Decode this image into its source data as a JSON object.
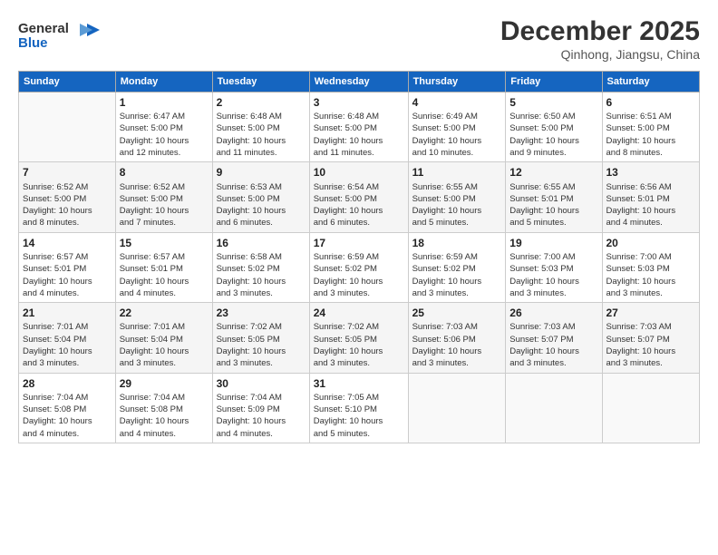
{
  "logo": {
    "line1": "General",
    "line2": "Blue"
  },
  "title": "December 2025",
  "subtitle": "Qinhong, Jiangsu, China",
  "headers": [
    "Sunday",
    "Monday",
    "Tuesday",
    "Wednesday",
    "Thursday",
    "Friday",
    "Saturday"
  ],
  "weeks": [
    [
      {
        "day": "",
        "info": ""
      },
      {
        "day": "1",
        "info": "Sunrise: 6:47 AM\nSunset: 5:00 PM\nDaylight: 10 hours\nand 12 minutes."
      },
      {
        "day": "2",
        "info": "Sunrise: 6:48 AM\nSunset: 5:00 PM\nDaylight: 10 hours\nand 11 minutes."
      },
      {
        "day": "3",
        "info": "Sunrise: 6:48 AM\nSunset: 5:00 PM\nDaylight: 10 hours\nand 11 minutes."
      },
      {
        "day": "4",
        "info": "Sunrise: 6:49 AM\nSunset: 5:00 PM\nDaylight: 10 hours\nand 10 minutes."
      },
      {
        "day": "5",
        "info": "Sunrise: 6:50 AM\nSunset: 5:00 PM\nDaylight: 10 hours\nand 9 minutes."
      },
      {
        "day": "6",
        "info": "Sunrise: 6:51 AM\nSunset: 5:00 PM\nDaylight: 10 hours\nand 8 minutes."
      }
    ],
    [
      {
        "day": "7",
        "info": "Sunrise: 6:52 AM\nSunset: 5:00 PM\nDaylight: 10 hours\nand 8 minutes."
      },
      {
        "day": "8",
        "info": "Sunrise: 6:52 AM\nSunset: 5:00 PM\nDaylight: 10 hours\nand 7 minutes."
      },
      {
        "day": "9",
        "info": "Sunrise: 6:53 AM\nSunset: 5:00 PM\nDaylight: 10 hours\nand 6 minutes."
      },
      {
        "day": "10",
        "info": "Sunrise: 6:54 AM\nSunset: 5:00 PM\nDaylight: 10 hours\nand 6 minutes."
      },
      {
        "day": "11",
        "info": "Sunrise: 6:55 AM\nSunset: 5:00 PM\nDaylight: 10 hours\nand 5 minutes."
      },
      {
        "day": "12",
        "info": "Sunrise: 6:55 AM\nSunset: 5:01 PM\nDaylight: 10 hours\nand 5 minutes."
      },
      {
        "day": "13",
        "info": "Sunrise: 6:56 AM\nSunset: 5:01 PM\nDaylight: 10 hours\nand 4 minutes."
      }
    ],
    [
      {
        "day": "14",
        "info": "Sunrise: 6:57 AM\nSunset: 5:01 PM\nDaylight: 10 hours\nand 4 minutes."
      },
      {
        "day": "15",
        "info": "Sunrise: 6:57 AM\nSunset: 5:01 PM\nDaylight: 10 hours\nand 4 minutes."
      },
      {
        "day": "16",
        "info": "Sunrise: 6:58 AM\nSunset: 5:02 PM\nDaylight: 10 hours\nand 3 minutes."
      },
      {
        "day": "17",
        "info": "Sunrise: 6:59 AM\nSunset: 5:02 PM\nDaylight: 10 hours\nand 3 minutes."
      },
      {
        "day": "18",
        "info": "Sunrise: 6:59 AM\nSunset: 5:02 PM\nDaylight: 10 hours\nand 3 minutes."
      },
      {
        "day": "19",
        "info": "Sunrise: 7:00 AM\nSunset: 5:03 PM\nDaylight: 10 hours\nand 3 minutes."
      },
      {
        "day": "20",
        "info": "Sunrise: 7:00 AM\nSunset: 5:03 PM\nDaylight: 10 hours\nand 3 minutes."
      }
    ],
    [
      {
        "day": "21",
        "info": "Sunrise: 7:01 AM\nSunset: 5:04 PM\nDaylight: 10 hours\nand 3 minutes."
      },
      {
        "day": "22",
        "info": "Sunrise: 7:01 AM\nSunset: 5:04 PM\nDaylight: 10 hours\nand 3 minutes."
      },
      {
        "day": "23",
        "info": "Sunrise: 7:02 AM\nSunset: 5:05 PM\nDaylight: 10 hours\nand 3 minutes."
      },
      {
        "day": "24",
        "info": "Sunrise: 7:02 AM\nSunset: 5:05 PM\nDaylight: 10 hours\nand 3 minutes."
      },
      {
        "day": "25",
        "info": "Sunrise: 7:03 AM\nSunset: 5:06 PM\nDaylight: 10 hours\nand 3 minutes."
      },
      {
        "day": "26",
        "info": "Sunrise: 7:03 AM\nSunset: 5:07 PM\nDaylight: 10 hours\nand 3 minutes."
      },
      {
        "day": "27",
        "info": "Sunrise: 7:03 AM\nSunset: 5:07 PM\nDaylight: 10 hours\nand 3 minutes."
      }
    ],
    [
      {
        "day": "28",
        "info": "Sunrise: 7:04 AM\nSunset: 5:08 PM\nDaylight: 10 hours\nand 4 minutes."
      },
      {
        "day": "29",
        "info": "Sunrise: 7:04 AM\nSunset: 5:08 PM\nDaylight: 10 hours\nand 4 minutes."
      },
      {
        "day": "30",
        "info": "Sunrise: 7:04 AM\nSunset: 5:09 PM\nDaylight: 10 hours\nand 4 minutes."
      },
      {
        "day": "31",
        "info": "Sunrise: 7:05 AM\nSunset: 5:10 PM\nDaylight: 10 hours\nand 5 minutes."
      },
      {
        "day": "",
        "info": ""
      },
      {
        "day": "",
        "info": ""
      },
      {
        "day": "",
        "info": ""
      }
    ]
  ]
}
